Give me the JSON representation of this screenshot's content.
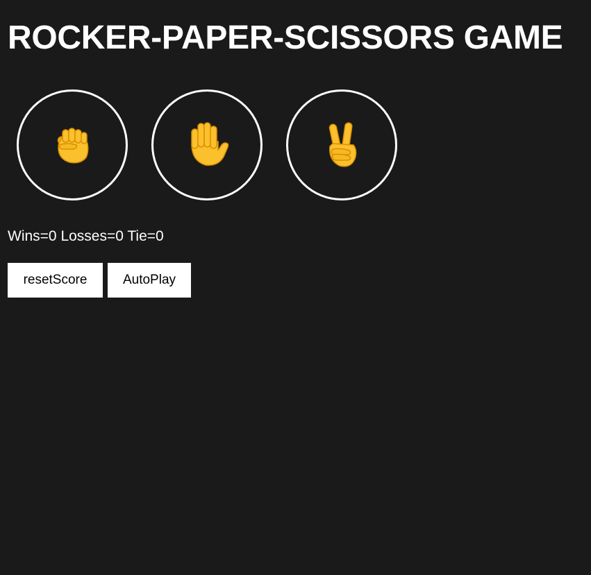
{
  "title": "ROCKER-PAPER-SCISSORS GAME",
  "moves": [
    {
      "name": "rock",
      "icon": "raised-fist-emoji"
    },
    {
      "name": "paper",
      "icon": "raised-hand-emoji"
    },
    {
      "name": "scissors",
      "icon": "victory-hand-emoji"
    }
  ],
  "score": {
    "text": "Wins=0 Losses=0 Tie=0",
    "wins": 0,
    "losses": 0,
    "ties": 0
  },
  "controls": {
    "reset_label": "resetScore",
    "autoplay_label": "AutoPlay"
  },
  "colors": {
    "background": "#1a1a1a",
    "foreground": "#ffffff",
    "emoji_skin": "#fbc02d",
    "emoji_shade": "#e0a000"
  }
}
